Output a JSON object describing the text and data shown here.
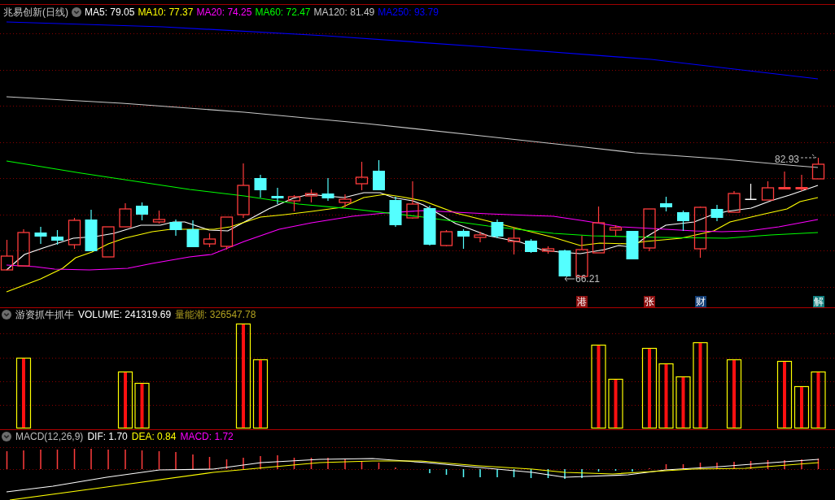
{
  "main_chart": {
    "title": "兆易创新(日线)",
    "legend": [
      {
        "text": "MA5: 79.05",
        "color": "#ffffff"
      },
      {
        "text": "MA10: 77.37",
        "color": "#ffff00"
      },
      {
        "text": "MA20: 74.25",
        "color": "#ff00ff"
      },
      {
        "text": "MA60: 72.47",
        "color": "#00ff00"
      },
      {
        "text": "MA120: 81.49",
        "color": "#c8c8c8"
      },
      {
        "text": "MA250: 93.79",
        "color": "#0000ff"
      }
    ],
    "high_label": "82.93",
    "low_label": "66.21",
    "events": [
      {
        "text": "港",
        "color": "#8c1010"
      },
      {
        "text": "张",
        "color": "#8c1010"
      },
      {
        "text": "财",
        "color": "#103c74"
      },
      {
        "text": "解",
        "color": "#107c7c"
      }
    ]
  },
  "volume_panel": {
    "indicator": "游资抓牛抓牛",
    "legend": [
      {
        "text": "VOLUME: 241319.69",
        "color": "#ffffff"
      },
      {
        "text": "量能潮: 326547.78",
        "color": "#b0a020"
      }
    ]
  },
  "macd_panel": {
    "indicator": "MACD(12,26,9)",
    "legend": [
      {
        "text": "DIF: 1.70",
        "color": "#ffffff"
      },
      {
        "text": "DEA: 0.84",
        "color": "#ffff00"
      },
      {
        "text": "MACD: 1.72",
        "color": "#ff00ff"
      }
    ]
  }
}
